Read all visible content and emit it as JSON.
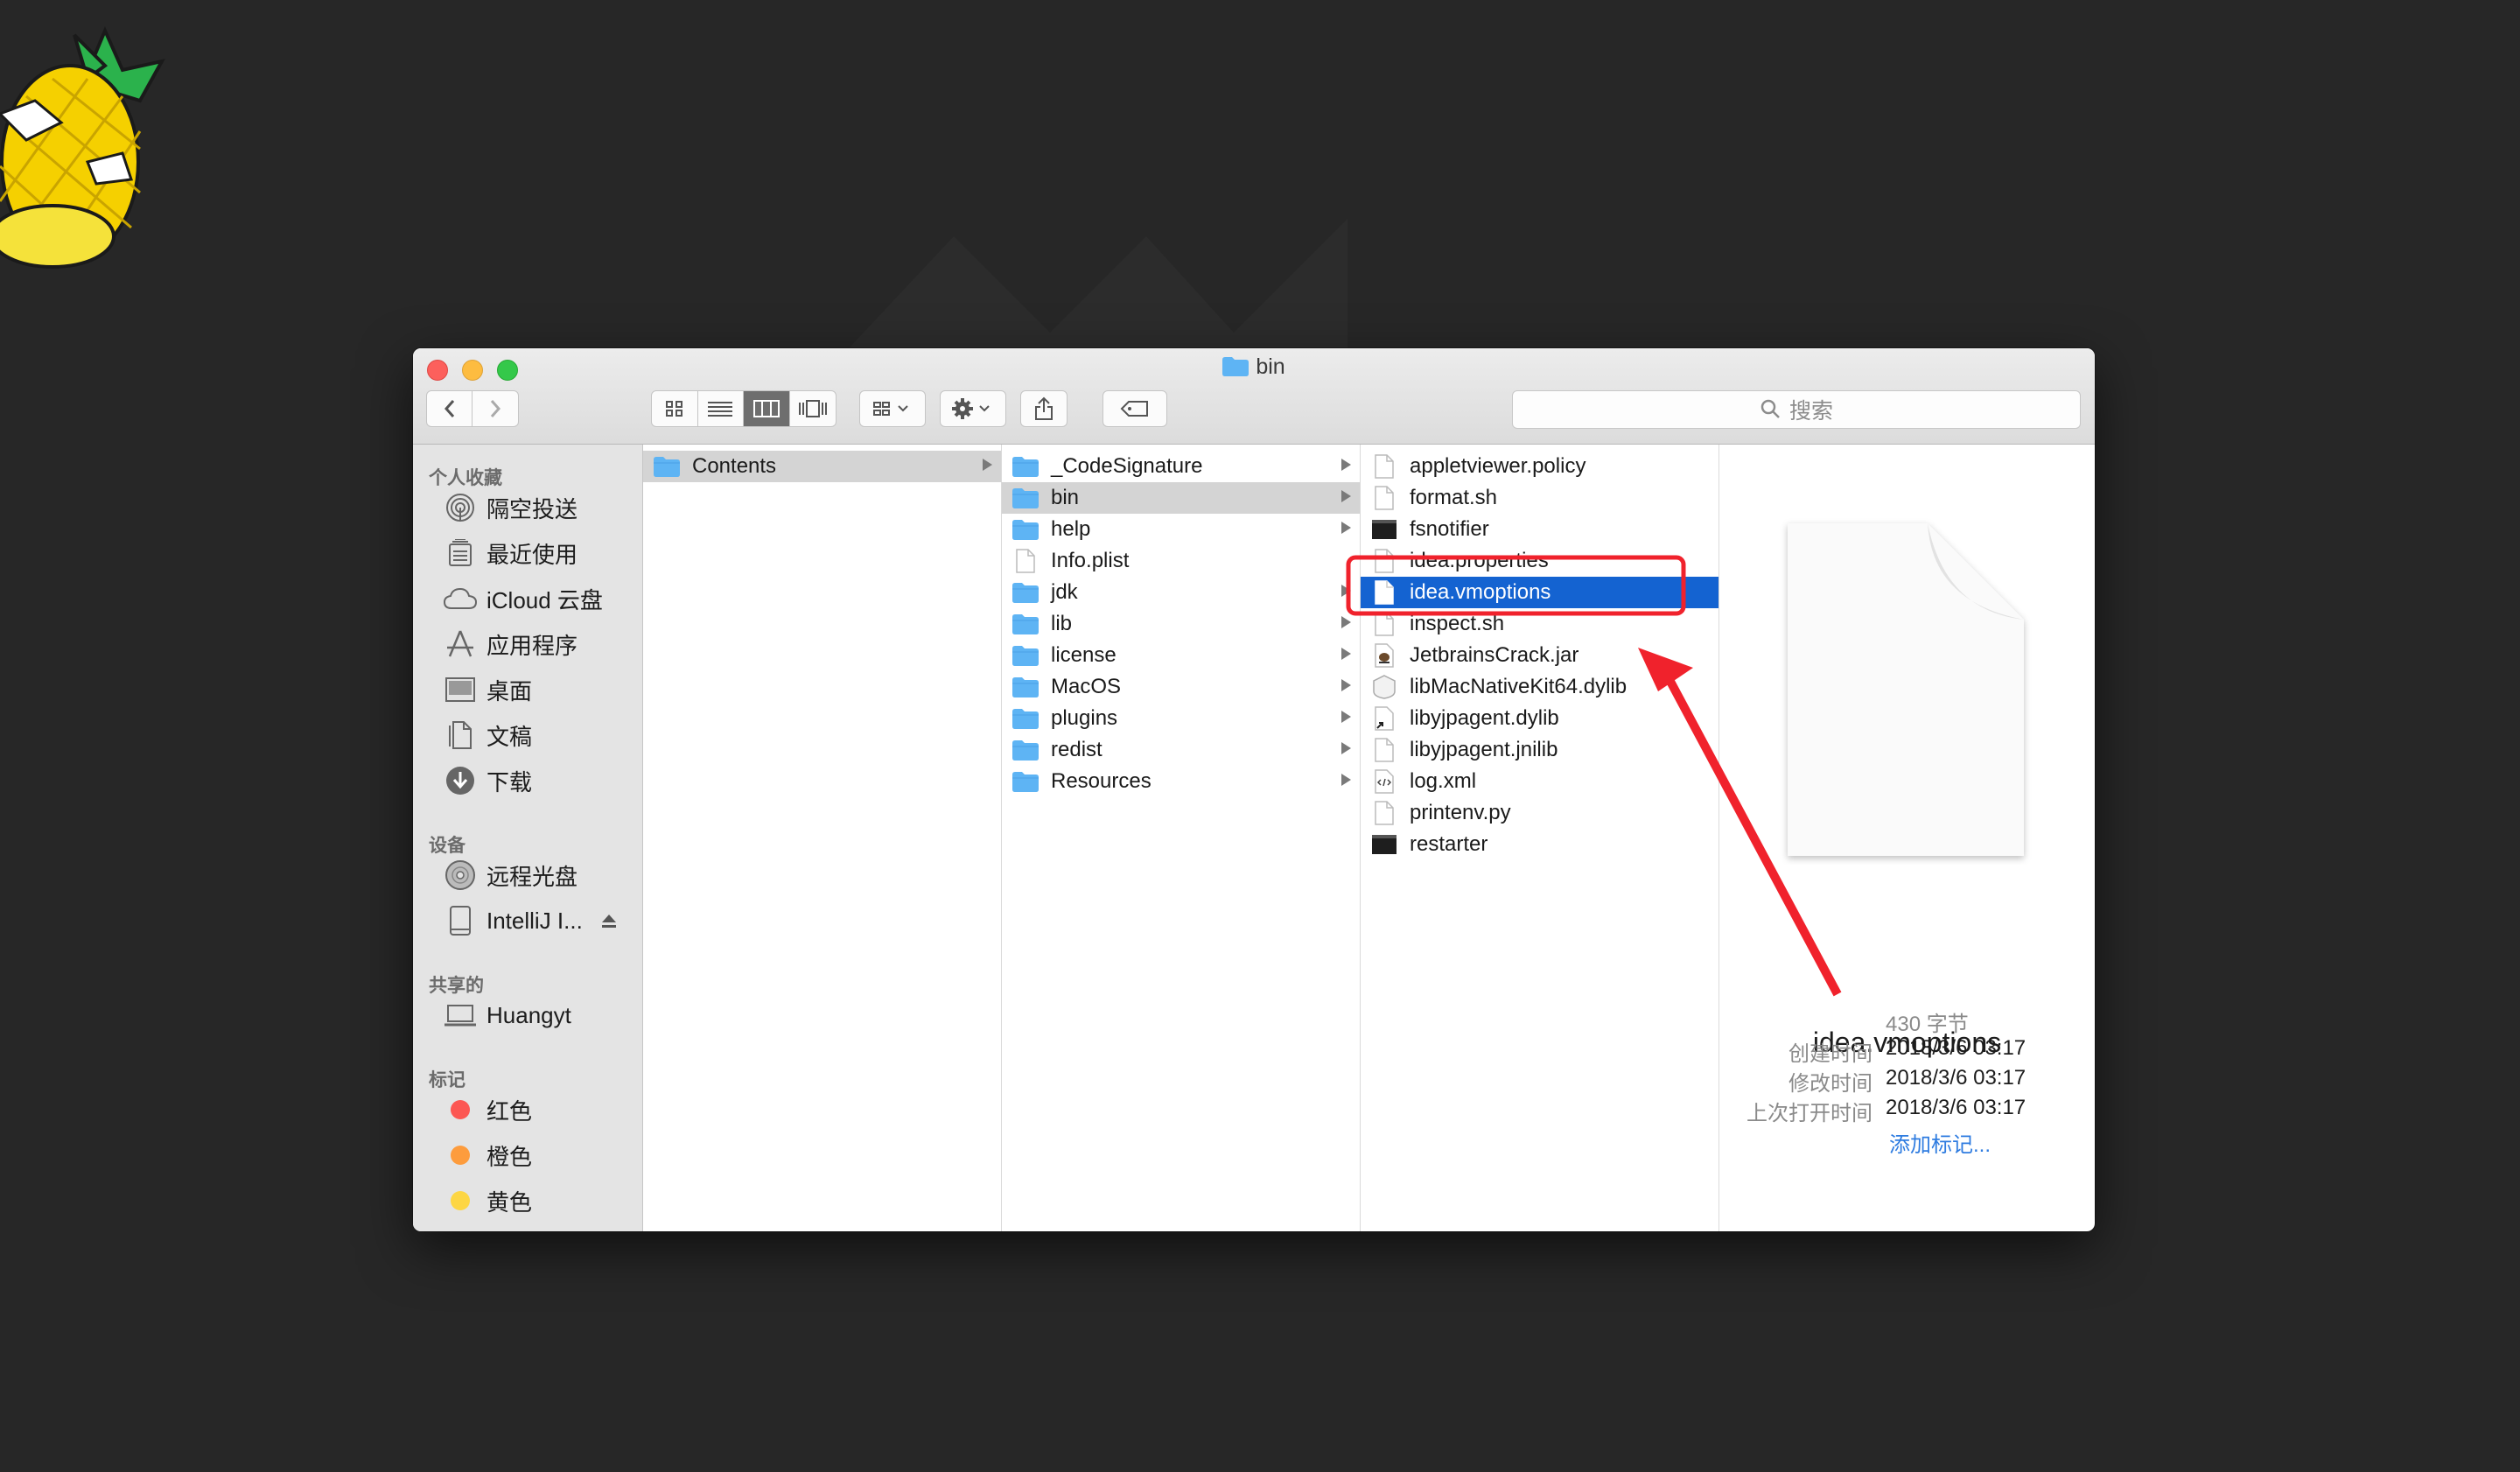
{
  "colors": {
    "accent": "#1463d1",
    "annotation": "#f0222c"
  },
  "window": {
    "title": "bin"
  },
  "toolbar": {
    "search_placeholder": "搜索"
  },
  "sidebar": {
    "favorites_header": "个人收藏",
    "favorites": [
      {
        "label": "隔空投送",
        "icon": "airdrop-icon"
      },
      {
        "label": "最近使用",
        "icon": "recents-icon"
      },
      {
        "label": "iCloud 云盘",
        "icon": "cloud-icon"
      },
      {
        "label": "应用程序",
        "icon": "applications-icon"
      },
      {
        "label": "桌面",
        "icon": "desktop-icon"
      },
      {
        "label": "文稿",
        "icon": "documents-icon"
      },
      {
        "label": "下载",
        "icon": "downloads-icon"
      }
    ],
    "devices_header": "设备",
    "devices": [
      {
        "label": "远程光盘",
        "icon": "disc-icon"
      },
      {
        "label": "IntelliJ I...",
        "icon": "drive-icon"
      }
    ],
    "shared_header": "共享的",
    "shared": [
      {
        "label": "Huangyt",
        "icon": "computer-icon"
      }
    ],
    "tags_header": "标记",
    "tags": [
      {
        "label": "红色",
        "color": "#fc5753"
      },
      {
        "label": "橙色",
        "color": "#fd9c3d"
      },
      {
        "label": "黄色",
        "color": "#fdd644"
      }
    ]
  },
  "columns": {
    "col1": [
      {
        "name": "Contents",
        "type": "folder"
      }
    ],
    "col2": [
      {
        "name": "_CodeSignature",
        "type": "folder"
      },
      {
        "name": "bin",
        "type": "folder"
      },
      {
        "name": "help",
        "type": "folder"
      },
      {
        "name": "Info.plist",
        "type": "file"
      },
      {
        "name": "jdk",
        "type": "folder"
      },
      {
        "name": "lib",
        "type": "folder"
      },
      {
        "name": "license",
        "type": "folder"
      },
      {
        "name": "MacOS",
        "type": "folder"
      },
      {
        "name": "plugins",
        "type": "folder"
      },
      {
        "name": "redist",
        "type": "folder"
      },
      {
        "name": "Resources",
        "type": "folder"
      }
    ],
    "col3": [
      {
        "name": "appletviewer.policy",
        "type": "file"
      },
      {
        "name": "format.sh",
        "type": "file"
      },
      {
        "name": "fsnotifier",
        "type": "exec"
      },
      {
        "name": "idea.properties",
        "type": "file"
      },
      {
        "name": "idea.vmoptions",
        "type": "file"
      },
      {
        "name": "inspect.sh",
        "type": "file"
      },
      {
        "name": "JetbrainsCrack.jar",
        "type": "jar"
      },
      {
        "name": "libMacNativeKit64.dylib",
        "type": "dylib"
      },
      {
        "name": "libyjpagent.dylib",
        "type": "alias"
      },
      {
        "name": "libyjpagent.jnilib",
        "type": "file"
      },
      {
        "name": "log.xml",
        "type": "xml"
      },
      {
        "name": "printenv.py",
        "type": "file"
      },
      {
        "name": "restarter",
        "type": "exec"
      }
    ]
  },
  "preview": {
    "name": "idea.vmoptions",
    "size": "430 字节",
    "created_label": "创建时间",
    "created": "2018/3/6 03:17",
    "modified_label": "修改时间",
    "modified": "2018/3/6 03:17",
    "opened_label": "上次打开时间",
    "opened": "2018/3/6 03:17",
    "add_tags": "添加标记..."
  }
}
